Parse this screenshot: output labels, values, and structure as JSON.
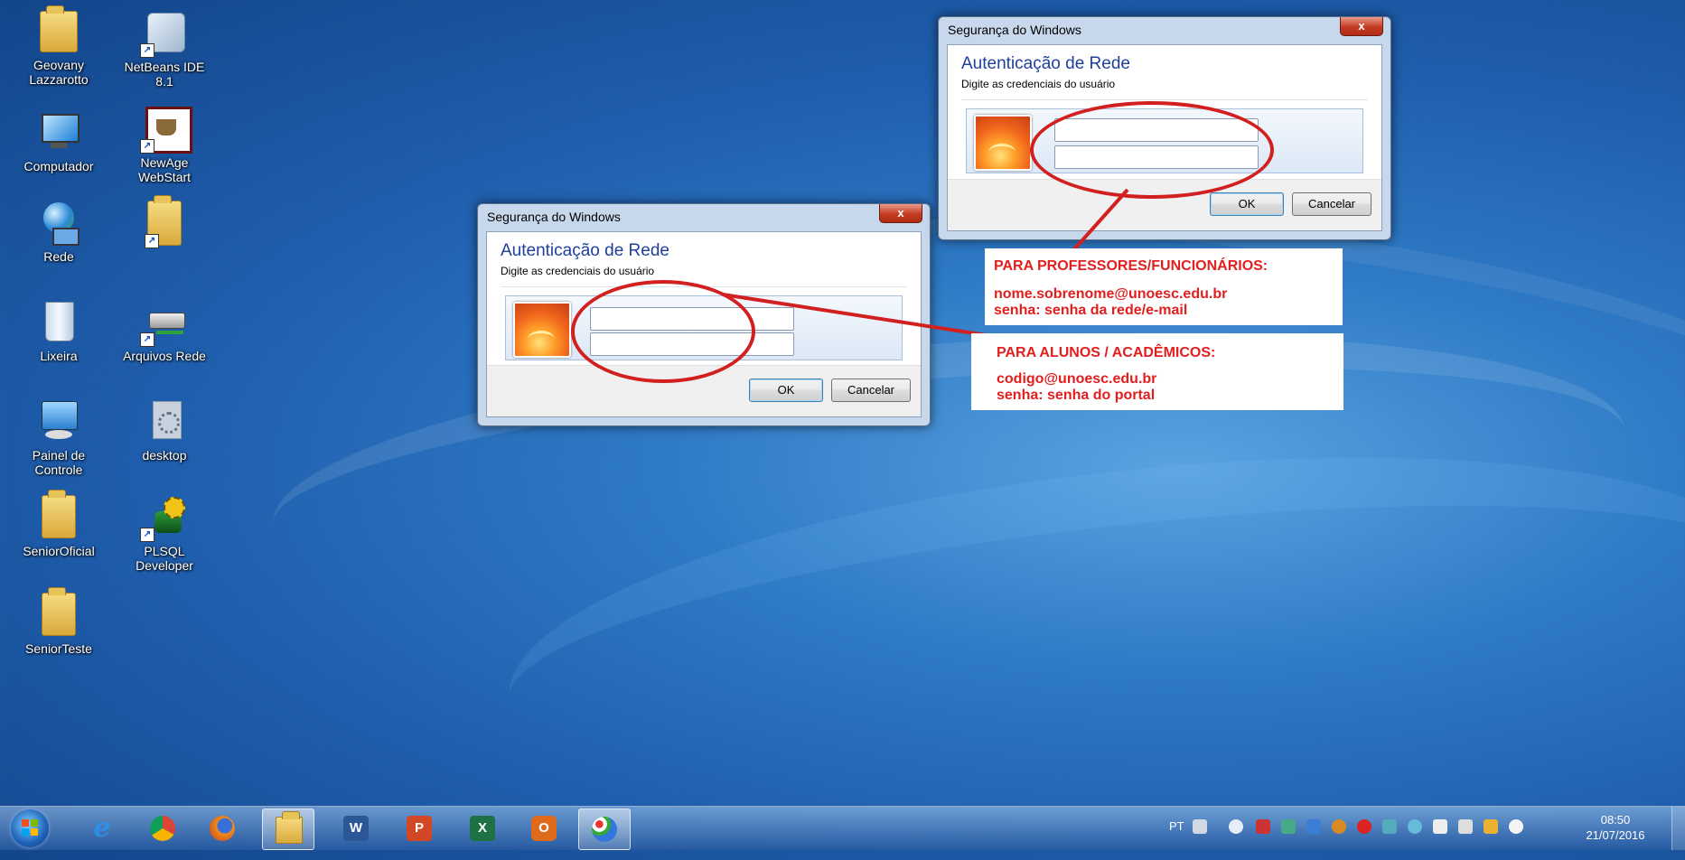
{
  "desktop_icons": [
    {
      "label": "Geovany Lazzarotto",
      "icon": "user-folder-icon"
    },
    {
      "label": "NetBeans IDE 8.1",
      "icon": "netbeans-icon"
    },
    {
      "label": "Computador",
      "icon": "computer-icon"
    },
    {
      "label": "NewAge WebStart",
      "icon": "java-webstart-icon"
    },
    {
      "label": "Rede",
      "icon": "network-icon"
    },
    {
      "label": "",
      "icon": "folder-shortcut-icon"
    },
    {
      "label": "Lixeira",
      "icon": "recycle-bin-icon"
    },
    {
      "label": "Arquivos Rede",
      "icon": "network-drive-icon"
    },
    {
      "label": "Painel de Controle",
      "icon": "control-panel-icon"
    },
    {
      "label": "desktop",
      "icon": "settings-file-icon"
    },
    {
      "label": "SeniorOficial",
      "icon": "folder-icon"
    },
    {
      "label": "PLSQL Developer",
      "icon": "plsql-developer-icon"
    },
    {
      "label": "SeniorTeste",
      "icon": "folder-icon"
    }
  ],
  "dialog": {
    "title": "Segurança do Windows",
    "close": "x",
    "heading": "Autenticação de Rede",
    "subheading": "Digite as credenciais do usuário",
    "username_value": "",
    "password_value": "",
    "ok_label": "OK",
    "cancel_label": "Cancelar"
  },
  "notes": {
    "staff_heading": "PARA PROFESSORES/FUNCIONÁRIOS:",
    "staff_user": "nome.sobrenome@unoesc.edu.br",
    "staff_pass": "senha: senha da rede/e-mail",
    "student_heading": "PARA ALUNOS / ACADÊMICOS:",
    "student_user": "codigo@unoesc.edu.br",
    "student_pass": "senha: senha do portal"
  },
  "taskbar": {
    "apps": [
      "internet-explorer-icon",
      "chrome-icon",
      "firefox-icon",
      "file-explorer-icon",
      "word-icon",
      "powerpoint-icon",
      "excel-icon",
      "outlook-icon",
      "paint-icon"
    ],
    "language": "PT",
    "time": "08:50",
    "date": "21/07/2016"
  },
  "colors": {
    "annotation_red": "#d21f1f",
    "note_text": "#e21e1e",
    "dialog_heading": "#1e3f9c"
  }
}
